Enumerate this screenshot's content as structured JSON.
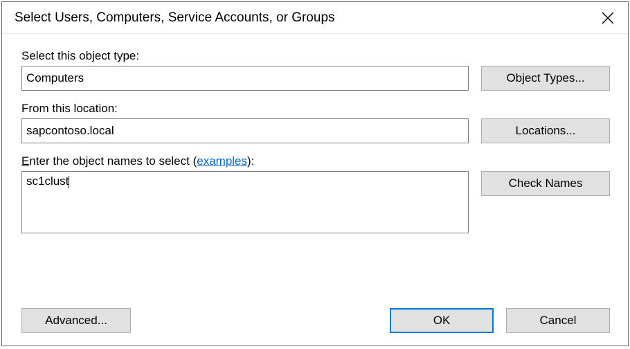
{
  "dialog": {
    "title": "Select Users, Computers, Service Accounts, or Groups"
  },
  "section_object_type": {
    "label": "Select this object type:",
    "value": "Computers",
    "button": "Object Types..."
  },
  "section_location": {
    "label": "From this location:",
    "value": "sapcontoso.local",
    "button": "Locations..."
  },
  "section_names": {
    "label_pre_u": "",
    "label_u": "E",
    "label_post_u": "nter the object names to select (",
    "examples_link": "examples",
    "label_close": "):",
    "value": "sc1clust",
    "button": "Check Names"
  },
  "buttons": {
    "advanced": "Advanced...",
    "ok": "OK",
    "cancel": "Cancel"
  }
}
